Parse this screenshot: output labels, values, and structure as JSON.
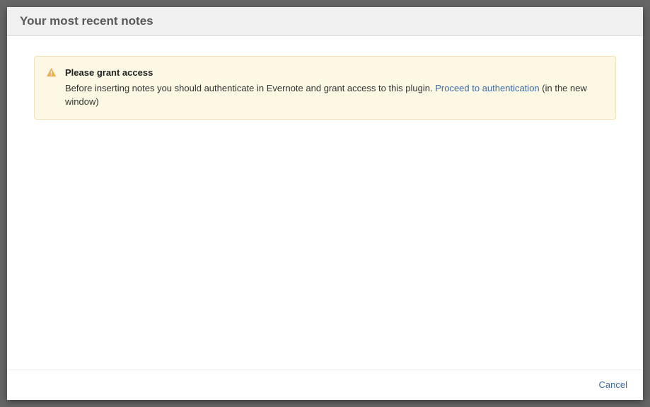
{
  "dialog": {
    "title": "Your most recent notes"
  },
  "alert": {
    "title": "Please grant access",
    "text_before": "Before inserting notes you should authenticate in Evernote and grant access to this plugin. ",
    "link_text": "Proceed to authentication",
    "text_after": " (in the new window)"
  },
  "footer": {
    "cancel": "Cancel"
  }
}
